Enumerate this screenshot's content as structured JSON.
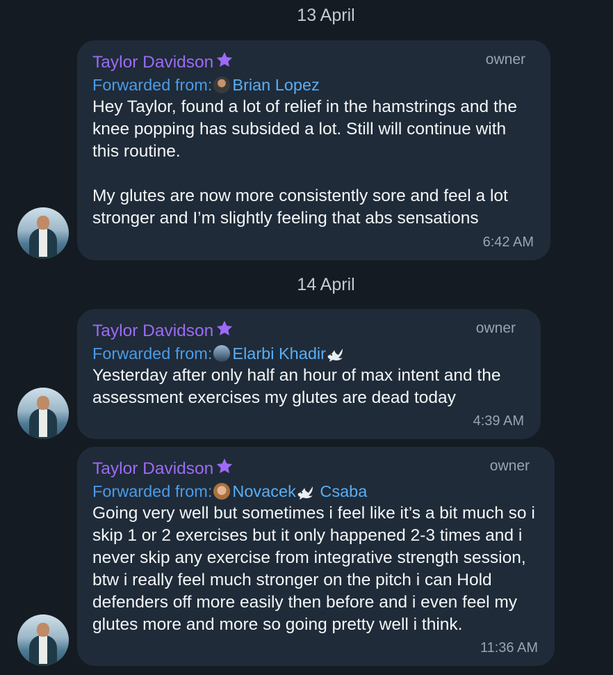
{
  "dates": [
    "13 April",
    "14 April"
  ],
  "messages": [
    {
      "sender": "Taylor Davidson",
      "role": "owner",
      "forwarded_label": "Forwarded from:",
      "forwarded_from": "Brian Lopez",
      "text": "Hey Taylor, found a lot of relief in the hamstrings and the knee popping has subsided a lot. Still will continue with this routine.\n\nMy glutes are now more consistently sore and feel a lot stronger and I’m slightly feeling that abs sensations",
      "time": "6:42 AM"
    },
    {
      "sender": "Taylor Davidson",
      "role": "owner",
      "forwarded_label": "Forwarded from:",
      "forwarded_from": "Elarbi Khadir",
      "text": "Yesterday after only half an hour of max intent and the assessment exercises my glutes are dead today",
      "time": "4:39 AM"
    },
    {
      "sender": "Taylor Davidson",
      "role": "owner",
      "forwarded_label": "Forwarded from:",
      "forwarded_from_first": "Novacek",
      "forwarded_from_last": "Csaba",
      "text": "Going very well but sometimes i feel like it’s a bit much so i skip 1 or 2 exercises but it only happened 2-3 times and i never skip any exercise from integrative strength session, btw i really feel much stronger on the pitch i can Hold defenders off more easily then before and i even feel my glutes more and more so going pretty well i think.",
      "time": "11:36 AM"
    }
  ],
  "colors": {
    "background": "#151b22",
    "bubble": "#1f2b38",
    "sender_name": "#9d6af6",
    "forwarded_link": "#5aaef4",
    "secondary_text": "#9aa4b0"
  },
  "icons": {
    "premium_badge": "star-icon",
    "emoji_status": "dove-icon"
  }
}
